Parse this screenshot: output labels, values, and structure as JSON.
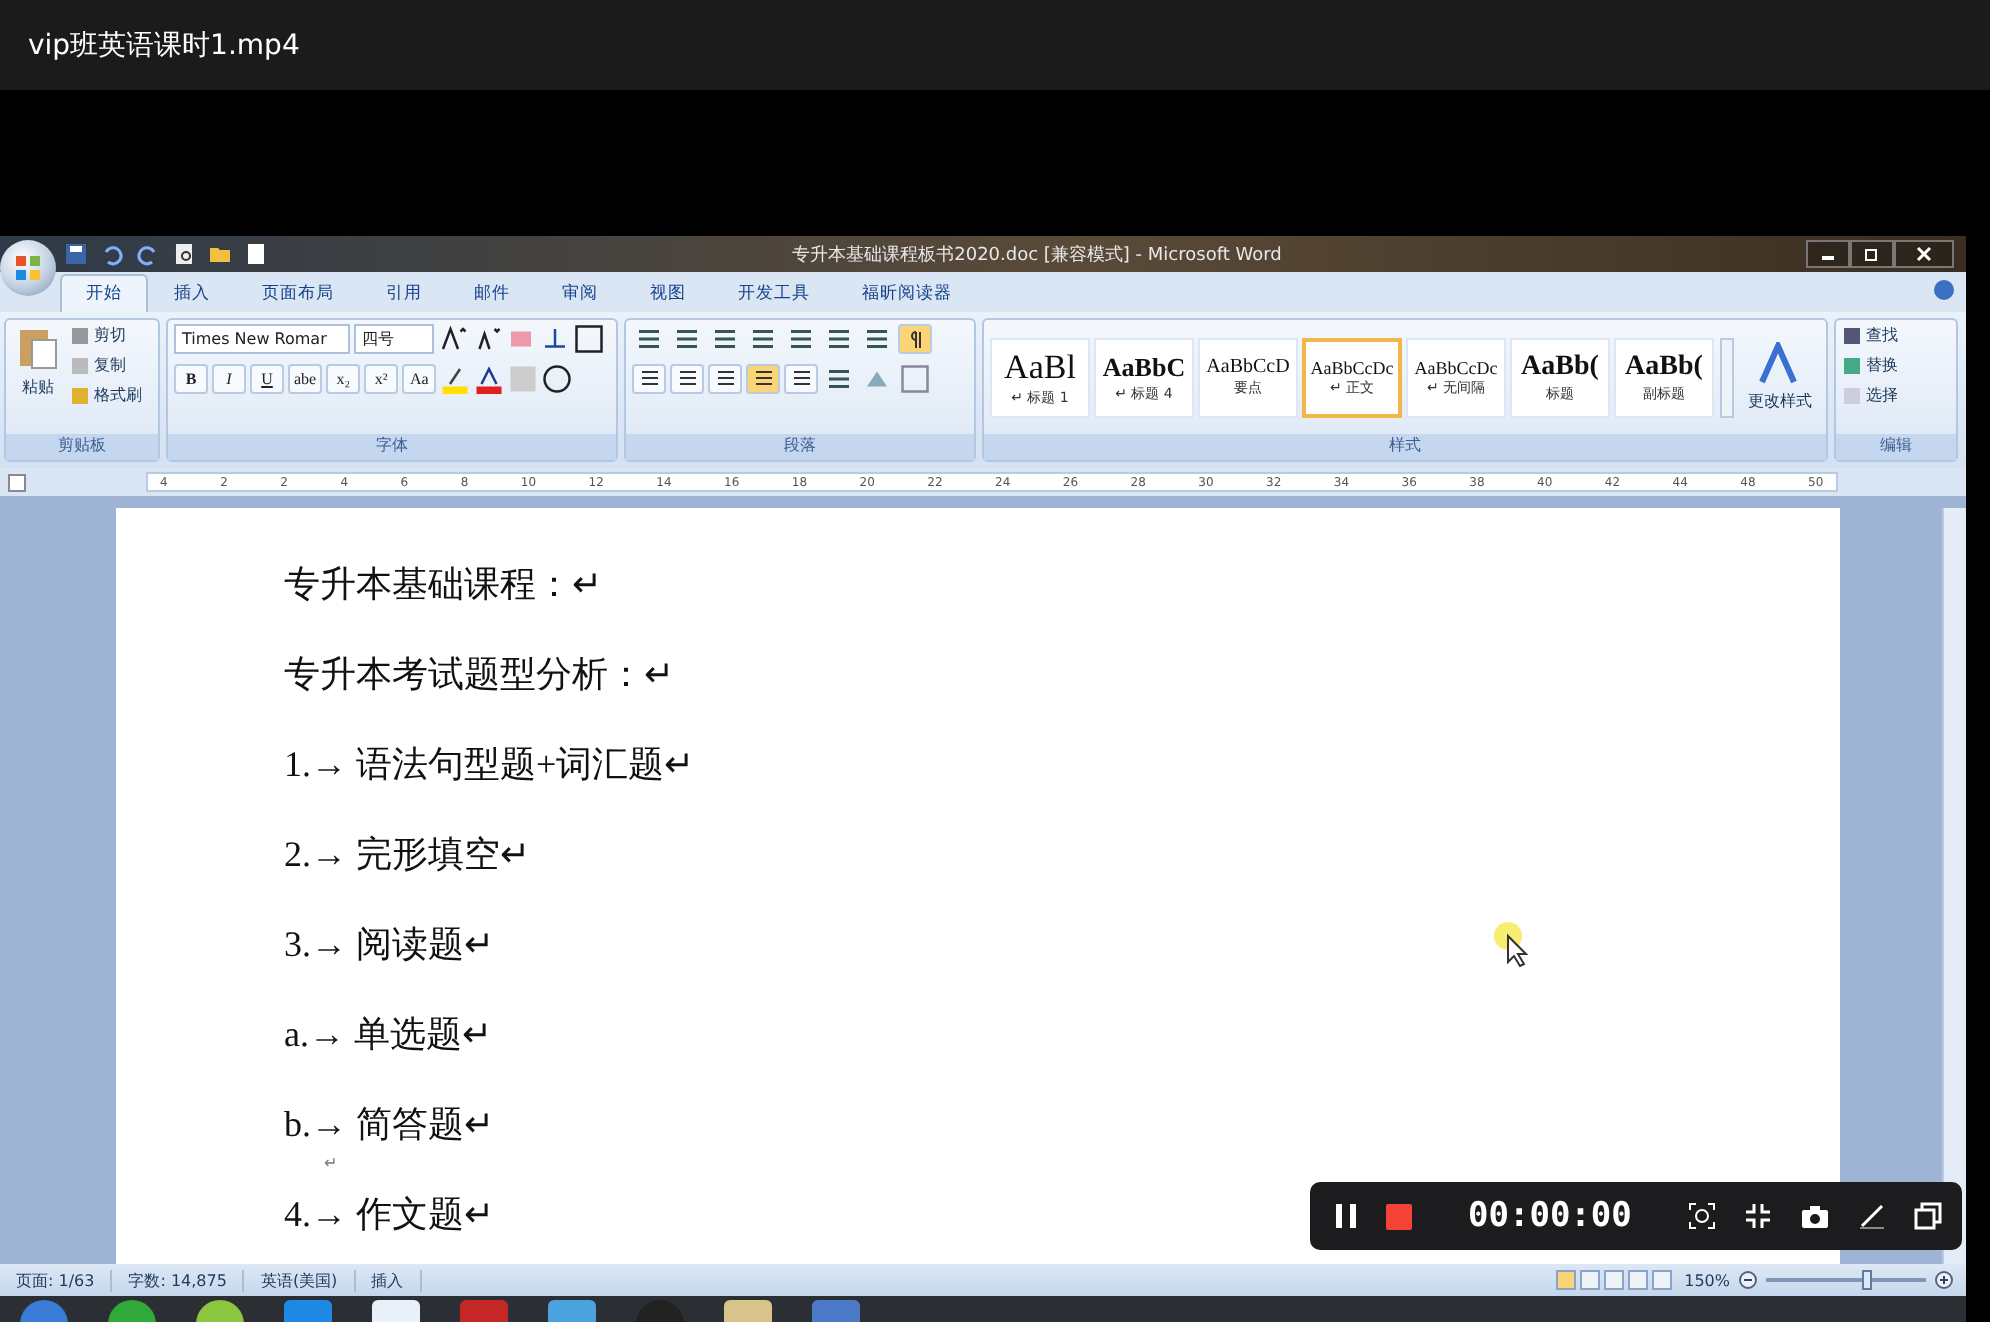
{
  "player": {
    "title": "vip班英语课时1.mp4"
  },
  "word": {
    "title": "专升本基础课程板书2020.doc [兼容模式] - Microsoft Word",
    "tabs": [
      {
        "label": "开始",
        "selected": true
      },
      {
        "label": "插入",
        "selected": false
      },
      {
        "label": "页面布局",
        "selected": false
      },
      {
        "label": "引用",
        "selected": false
      },
      {
        "label": "邮件",
        "selected": false
      },
      {
        "label": "审阅",
        "selected": false
      },
      {
        "label": "视图",
        "selected": false
      },
      {
        "label": "开发工具",
        "selected": false
      },
      {
        "label": "福昕阅读器",
        "selected": false
      }
    ],
    "clipboard": {
      "label": "剪贴板",
      "paste": "粘贴",
      "items": [
        "剪切",
        "复制",
        "格式刷"
      ]
    },
    "font": {
      "label": "字体",
      "name": "Times New Romar",
      "size": "四号",
      "buttons": [
        "B",
        "I",
        "U",
        "abe",
        "x₂",
        "x²",
        "Aa"
      ]
    },
    "paragraph": {
      "label": "段落",
      "align": [
        {
          "selected": false
        },
        {
          "selected": false
        },
        {
          "selected": false
        },
        {
          "selected": true
        },
        {
          "selected": false
        }
      ],
      "show_marks": true
    },
    "styles": {
      "label": "样式",
      "change": "更改样式",
      "items": [
        {
          "preview": "AaBl",
          "label": "↵ 标题 1",
          "selected": false
        },
        {
          "preview": "AaBbC",
          "label": "↵ 标题 4",
          "selected": false
        },
        {
          "preview": "AaBbCcD",
          "label": "要点",
          "selected": false
        },
        {
          "preview": "AaBbCcDc",
          "label": "↵ 正文",
          "selected": true
        },
        {
          "preview": "AaBbCcDc",
          "label": "↵ 无间隔",
          "selected": false
        },
        {
          "preview": "AaBb(",
          "label": "标题",
          "selected": false
        },
        {
          "preview": "AaBb(",
          "label": "副标题",
          "selected": false
        }
      ]
    },
    "editing": {
      "label": "编辑",
      "items": [
        "查找",
        "替换",
        "选择"
      ]
    },
    "ruler": [
      "4",
      "2",
      "2",
      "4",
      "6",
      "8",
      "10",
      "12",
      "14",
      "16",
      "18",
      "20",
      "22",
      "24",
      "26",
      "28",
      "30",
      "32",
      "34",
      "36",
      "38",
      "40",
      "42",
      "44",
      "48",
      "50"
    ],
    "document": [
      "专升本基础课程：↵",
      "专升本考试题型分析：↵",
      "1.→ 语法句型题+词汇题↵",
      "2.→ 完形填空↵",
      "3.→ 阅读题↵",
      "a.→ 单选题↵",
      "b.→ 简答题↵",
      "↵",
      "4.→ 作文题↵"
    ],
    "status": [
      "页面: 1/63",
      "字数: 14,875",
      "英语(美国)",
      "插入"
    ],
    "views": [
      {
        "selected": true
      },
      {
        "selected": false
      },
      {
        "selected": false
      },
      {
        "selected": false
      },
      {
        "selected": false
      }
    ],
    "zoom": {
      "reading": "150%",
      "level": 0.6
    }
  },
  "recorder": {
    "time": "00:00:00",
    "recording": true
  }
}
